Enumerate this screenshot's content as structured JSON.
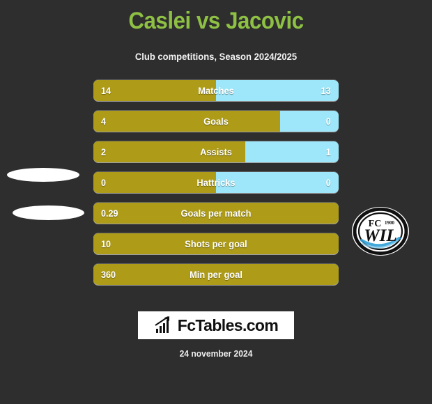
{
  "header": {
    "title": "Caslei vs Jacovic",
    "subtitle": "Club competitions, Season 2024/2025",
    "title_color": "#8ec044",
    "subtitle_color": "#f2f2f2"
  },
  "theme": {
    "background": "#2e2e2e",
    "left_bar_color": "#ae9c18",
    "right_bar_color": "#9ee7fa",
    "text_color": "#ffffff"
  },
  "teams": {
    "left": {
      "crest": "placeholder-ellipse"
    },
    "right": {
      "crest": "fc-wil-1900-crest",
      "crest_line1": "FC",
      "crest_year": "1900",
      "crest_line2": "WIL"
    }
  },
  "chart_data": {
    "type": "bar",
    "title": "Caslei vs Jacovic",
    "subtitle": "Club competitions, Season 2024/2025",
    "orientation": "horizontal-diverging",
    "series": [
      {
        "name": "Caslei",
        "color": "#ae9c18",
        "side": "left"
      },
      {
        "name": "Jacovic",
        "color": "#9ee7fa",
        "side": "right"
      }
    ],
    "categories": [
      "Matches",
      "Goals",
      "Assists",
      "Hattricks",
      "Goals per match",
      "Shots per goal",
      "Min per goal"
    ],
    "rows": [
      {
        "label": "Matches",
        "left_value": "14",
        "right_value": "13",
        "left_pct": 50,
        "two_sided": true
      },
      {
        "label": "Goals",
        "left_value": "4",
        "right_value": "0",
        "left_pct": 76,
        "two_sided": true
      },
      {
        "label": "Assists",
        "left_value": "2",
        "right_value": "1",
        "left_pct": 62,
        "two_sided": true
      },
      {
        "label": "Hattricks",
        "left_value": "0",
        "right_value": "0",
        "left_pct": 50,
        "two_sided": true
      },
      {
        "label": "Goals per match",
        "left_value": "0.29",
        "right_value": "",
        "left_pct": 100,
        "two_sided": false
      },
      {
        "label": "Shots per goal",
        "left_value": "10",
        "right_value": "",
        "left_pct": 100,
        "two_sided": false
      },
      {
        "label": "Min per goal",
        "left_value": "360",
        "right_value": "",
        "left_pct": 100,
        "two_sided": false
      }
    ]
  },
  "footer": {
    "logo_text": "FcTables.com",
    "logo_icon": "bar-chart-arrow-icon",
    "date": "24 november 2024"
  }
}
